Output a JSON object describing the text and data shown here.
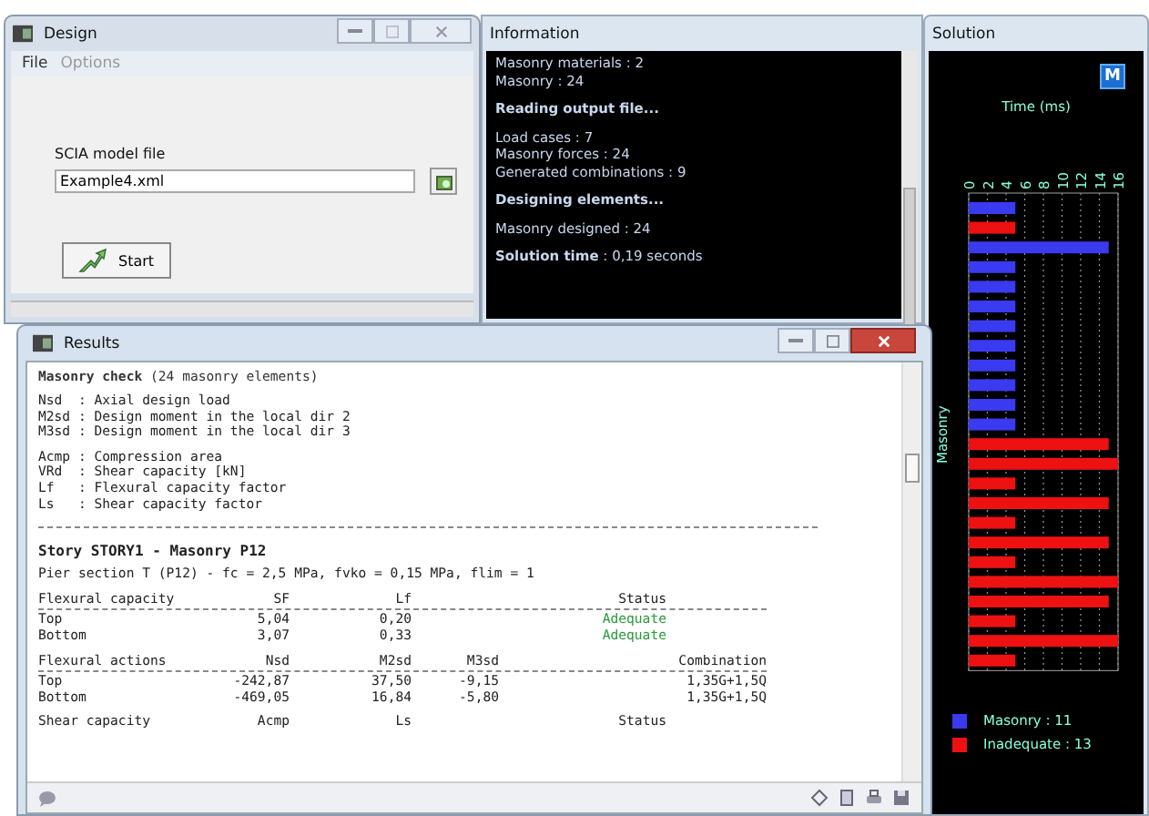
{
  "design_window": {
    "title": "Design",
    "menu": [
      {
        "label": "File",
        "disabled": false
      },
      {
        "label": "Options",
        "disabled": true
      }
    ],
    "field_label": "SCIA model file",
    "file_value": "Example4.xml",
    "start_button": "Start"
  },
  "information": {
    "title": "Information",
    "lines": [
      {
        "kind": "text",
        "text": "Masonry materials : 2"
      },
      {
        "kind": "text",
        "text": "Masonry : 24"
      },
      {
        "kind": "heading",
        "text": "Reading output file..."
      },
      {
        "kind": "text",
        "text": "Load cases : 7"
      },
      {
        "kind": "text",
        "text": "Masonry forces : 24"
      },
      {
        "kind": "text",
        "text": "Generated combinations : 9"
      },
      {
        "kind": "heading",
        "text": "Designing elements..."
      },
      {
        "kind": "text",
        "text": "Masonry designed : 24"
      },
      {
        "kind": "result",
        "text": "**Solution time** : 0,19 seconds"
      }
    ]
  },
  "solution": {
    "title": "Solution",
    "mode_button": "M",
    "chart_data": {
      "type": "bar",
      "orientation": "horizontal",
      "xlabel": "Time (ms)",
      "ylabel": "Masonry",
      "xlim": [
        0,
        16
      ],
      "xticks": [
        0,
        2,
        4,
        6,
        8,
        10,
        12,
        14,
        16
      ],
      "grid": true,
      "series": [
        {
          "name": "Masonry : 11",
          "color": "#3a3af0",
          "values": [
            5,
            null,
            15,
            5,
            5,
            5,
            5,
            5,
            5,
            5,
            5,
            5,
            null,
            null,
            null,
            null,
            null,
            null,
            null,
            null,
            null,
            null,
            null,
            null
          ]
        },
        {
          "name": "Inadequate : 13",
          "color": "#ee1111",
          "values": [
            null,
            5,
            null,
            null,
            null,
            null,
            null,
            null,
            null,
            null,
            null,
            null,
            15,
            16,
            5,
            15,
            5,
            15,
            5,
            16,
            15,
            5,
            16,
            5
          ]
        }
      ]
    }
  },
  "results": {
    "title": "Results",
    "heading": "**Masonry check** (24 masonry elements)",
    "definition_groups": [
      [
        "Nsd  : Axial design load",
        "M2sd : Design moment in the local dir 2",
        "M3sd : Design moment in the local dir 3"
      ],
      [
        "Acmp : Compression area",
        "VRd  : Shear capacity [kN]",
        "Lf   : Flexural capacity factor",
        "Ls   : Shear capacity factor"
      ]
    ],
    "story": "Story STORY1 - Masonry P12",
    "section": "Pier section T (P12) - fc = 2,5 MPa, fvko = 0,15 MPa, flim = 1",
    "tables": [
      {
        "header": {
          "label": "Flexural capacity",
          "c1": "SF",
          "c2": "Lf",
          "status": "Status"
        },
        "rows": [
          {
            "label": "Top",
            "c1": "5,04",
            "c2": "0,20",
            "status": "Adequate",
            "adequate": true
          },
          {
            "label": "Bottom",
            "c1": "3,07",
            "c2": "0,33",
            "status": "Adequate",
            "adequate": true
          }
        ]
      },
      {
        "header": {
          "label": "Flexural actions",
          "c1": "Nsd",
          "c2": "M2sd",
          "c3": "M3sd",
          "combination": "Combination"
        },
        "rows": [
          {
            "label": "Top",
            "c1": "-242,87",
            "c2": "37,50",
            "c3": "-9,15",
            "combination": "1,35G+1,5Q"
          },
          {
            "label": "Bottom",
            "c1": "-469,05",
            "c2": "16,84",
            "c3": "-5,80",
            "combination": "1,35G+1,5Q"
          }
        ]
      },
      {
        "header": {
          "label": "Shear capacity",
          "c1": "Acmp",
          "c2": "Ls",
          "status": "Status"
        }
      }
    ]
  }
}
